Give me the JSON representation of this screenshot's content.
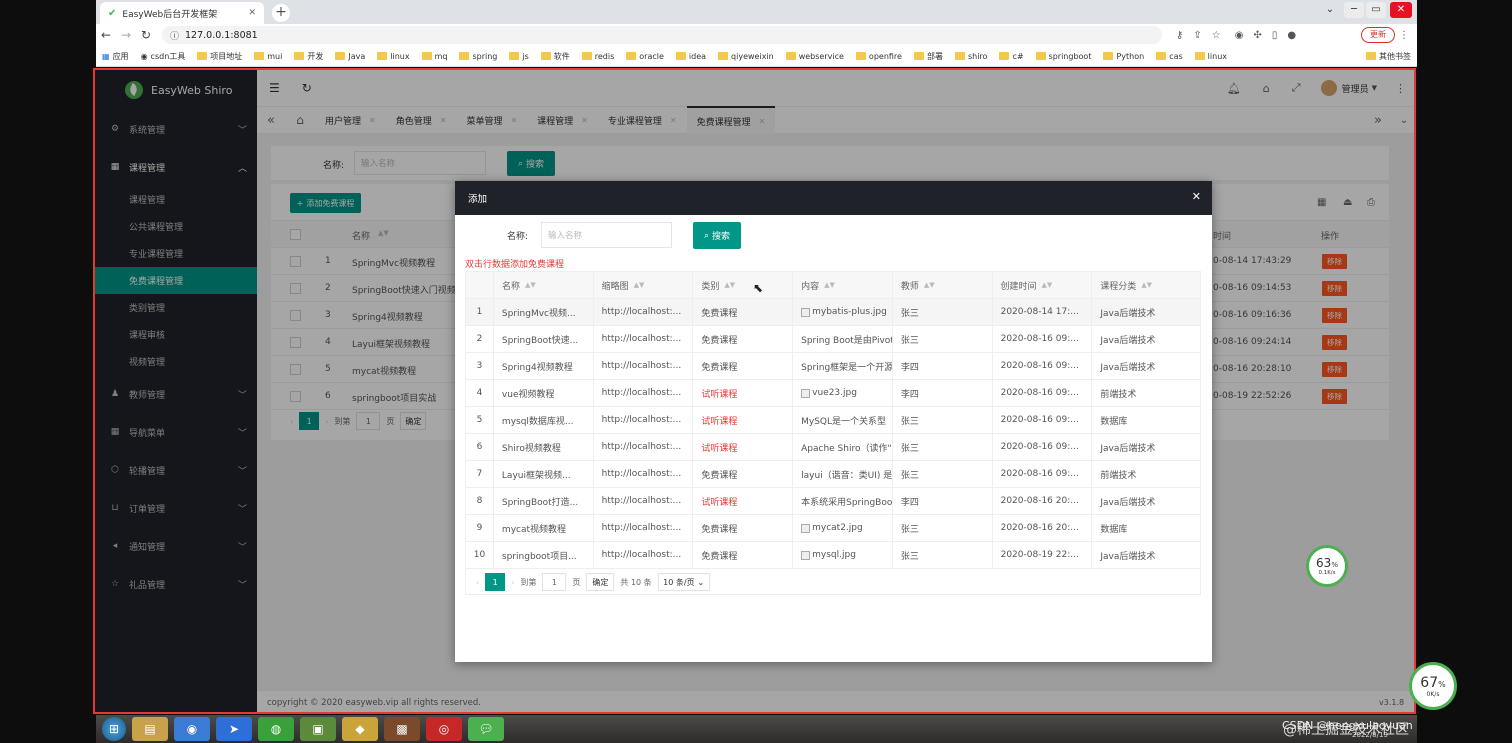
{
  "browser": {
    "tab_title": "EasyWeb后台开发框架",
    "url": "127.0.0.1:8081",
    "update_label": "更新",
    "bookmarks": [
      "应用",
      "csdn工具",
      "项目地址",
      "mui",
      "开发",
      "Java",
      "linux",
      "mq",
      "spring",
      "js",
      "软件",
      "redis",
      "oracle",
      "idea",
      "qiyeweixin",
      "webservice",
      "openfire",
      "部署",
      "shiro",
      "c#",
      "springboot",
      "Python",
      "cas",
      "linux"
    ],
    "other_bookmarks": "其他书签"
  },
  "app": {
    "brand": "EasyWeb Shiro",
    "user": "管理员",
    "footer": "copyright © 2020 easyweb.vip all rights reserved.",
    "version": "v3.1.8"
  },
  "sidebar": {
    "menus": [
      {
        "label": "系统管理",
        "icon": "gear-icon"
      },
      {
        "label": "课程管理",
        "icon": "grid-icon",
        "open": true,
        "children": [
          "课程管理",
          "公共课程管理",
          "专业课程管理",
          "免费课程管理",
          "类别管理",
          "课程审核",
          "视频管理"
        ],
        "active": 3
      },
      {
        "label": "教师管理",
        "icon": "user-icon"
      },
      {
        "label": "导航菜单",
        "icon": "grid-icon"
      },
      {
        "label": "轮播管理",
        "icon": "cube-icon"
      },
      {
        "label": "订单管理",
        "icon": "cart-icon"
      },
      {
        "label": "通知管理",
        "icon": "speaker-icon"
      },
      {
        "label": "礼品管理",
        "icon": "star-icon"
      }
    ]
  },
  "page_tabs": [
    "用户管理",
    "角色管理",
    "菜单管理",
    "课程管理",
    "专业课程管理",
    "免费课程管理"
  ],
  "page_tabs_active": 5,
  "bg": {
    "search_label": "名称:",
    "search_placeholder": "输入名称",
    "search_button": "搜索",
    "add_button": "添加免费课程",
    "col_name": "名称",
    "col_time": "时间",
    "col_action": "操作",
    "delete_label": "移除",
    "rows": [
      {
        "no": "1",
        "name": "SpringMvc视频教程",
        "time": "0-08-14 17:43:29"
      },
      {
        "no": "2",
        "name": "SpringBoot快速入门视频",
        "time": "0-08-16 09:14:53"
      },
      {
        "no": "3",
        "name": "Spring4视频教程",
        "time": "0-08-16 09:16:36"
      },
      {
        "no": "4",
        "name": "Layui框架视频教程",
        "time": "0-08-16 09:24:14"
      },
      {
        "no": "5",
        "name": "mycat视频教程",
        "time": "0-08-16 20:28:10"
      },
      {
        "no": "6",
        "name": "springboot项目实战",
        "time": "0-08-19 22:52:26"
      }
    ],
    "pager": {
      "page": "1",
      "goto": "到第",
      "page_input": "1",
      "page_unit": "页",
      "confirm": "确定"
    }
  },
  "modal": {
    "title": "添加",
    "search_label": "名称:",
    "search_placeholder": "输入名称",
    "search_button": "搜索",
    "hint": "双击行数据添加免费课程",
    "columns": [
      "名称",
      "缩略图",
      "类别",
      "内容",
      "教师",
      "创建时间",
      "课程分类"
    ],
    "rows": [
      {
        "no": "1",
        "name": "SpringMvc视频...",
        "thumb": "http://localhost:...",
        "type": "免费课程",
        "content": "mybatis-plus.jpg",
        "content_img": true,
        "teacher": "张三",
        "created": "2020-08-14 17:...",
        "category": "Java后端技术"
      },
      {
        "no": "2",
        "name": "SpringBoot快速...",
        "thumb": "http://localhost:...",
        "type": "免费课程",
        "content": "Spring Boot是由Pivot",
        "teacher": "张三",
        "created": "2020-08-16 09:...",
        "category": "Java后端技术"
      },
      {
        "no": "3",
        "name": "Spring4视频教程",
        "thumb": "http://localhost:...",
        "type": "免费课程",
        "content": "Spring框架是一个开源",
        "teacher": "李四",
        "created": "2020-08-16 09:...",
        "category": "Java后端技术"
      },
      {
        "no": "4",
        "name": "vue视频教程",
        "thumb": "http://localhost:...",
        "type": "试听课程",
        "trial": true,
        "content": "vue23.jpg",
        "content_img": true,
        "teacher": "李四",
        "created": "2020-08-16 09:...",
        "category": "前端技术"
      },
      {
        "no": "5",
        "name": "mysql数据库视...",
        "thumb": "http://localhost:...",
        "type": "试听课程",
        "trial": true,
        "content": "MySQL是一个关系型",
        "teacher": "张三",
        "created": "2020-08-16 09:...",
        "category": "数据库"
      },
      {
        "no": "6",
        "name": "Shiro视频教程",
        "thumb": "http://localhost:...",
        "type": "试听课程",
        "trial": true,
        "content": "Apache Shiro（读作\"",
        "teacher": "张三",
        "created": "2020-08-16 09:...",
        "category": "Java后端技术"
      },
      {
        "no": "7",
        "name": "Layui框架视频...",
        "thumb": "http://localhost:...",
        "type": "免费课程",
        "content": "layui（谐音：类UI) 是",
        "teacher": "张三",
        "created": "2020-08-16 09:...",
        "category": "前端技术"
      },
      {
        "no": "8",
        "name": "SpringBoot打造...",
        "thumb": "http://localhost:...",
        "type": "试听课程",
        "trial": true,
        "content": "本系统采用SpringBoo",
        "teacher": "李四",
        "created": "2020-08-16 20:...",
        "category": "Java后端技术"
      },
      {
        "no": "9",
        "name": "mycat视频教程",
        "thumb": "http://localhost:...",
        "type": "免费课程",
        "content": "mycat2.jpg",
        "content_img": true,
        "teacher": "张三",
        "created": "2020-08-16 20:...",
        "category": "数据库"
      },
      {
        "no": "10",
        "name": "springboot项目...",
        "thumb": "http://localhost:...",
        "type": "免费课程",
        "content": "mysql.jpg",
        "content_img": true,
        "teacher": "张三",
        "created": "2020-08-19 22:...",
        "category": "Java后端技术"
      }
    ],
    "pager": {
      "page": "1",
      "goto": "到第",
      "page_input": "1",
      "page_unit": "页",
      "confirm": "确定",
      "total": "共 10 条",
      "per_page": "10 条/页"
    }
  },
  "overlay": {
    "gauge1_pct": "63",
    "gauge1_unit": "%",
    "gauge1_speed": "0.1K/s",
    "gauge2_pct": "67",
    "gauge2_unit": "%",
    "gauge2_speed": "0K/s",
    "watermark": "@稀土掘金技术社区",
    "watermark2": "CSDN @hengxulaoyuan",
    "clock_time": "2022/8/19"
  }
}
